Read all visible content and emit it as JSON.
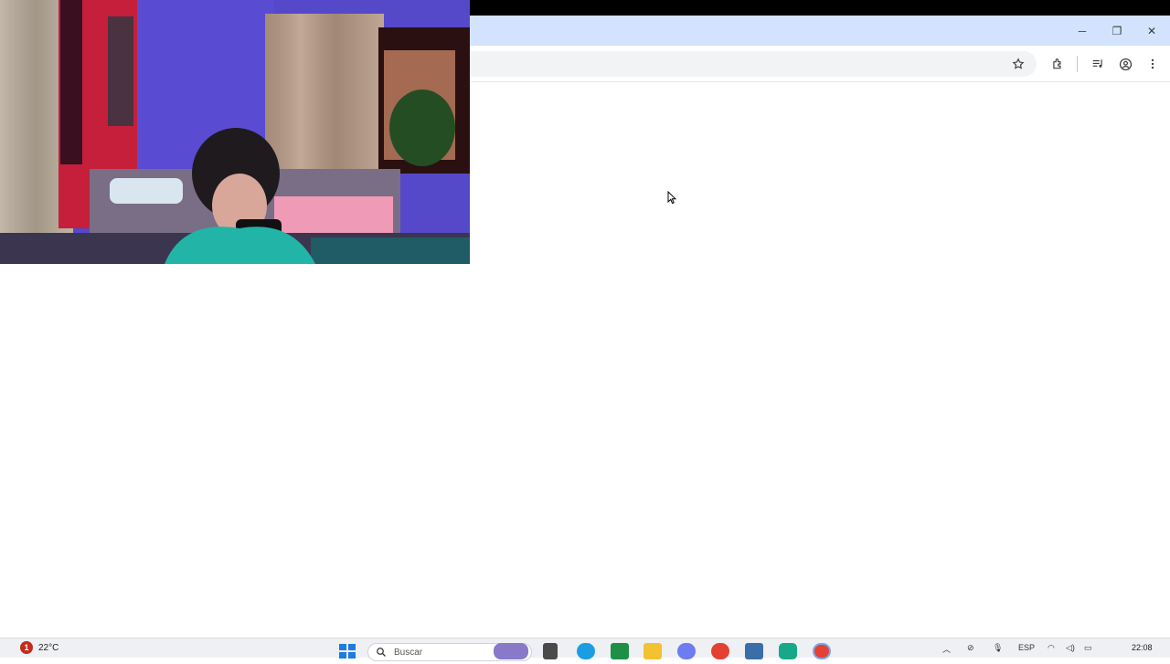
{
  "browser": {
    "window_controls": {
      "minimize": "─",
      "restore": "❐",
      "close": "✕"
    },
    "toolbar_icons": [
      "bookmark-star-icon",
      "extensions-icon",
      "media-controls-icon",
      "profile-icon",
      "menu-icon"
    ]
  },
  "taskbar": {
    "weather": {
      "alert_badge": "1",
      "temperature": "22°C"
    },
    "search_placeholder": "Buscar",
    "apps": [
      "start-icon",
      "search-icon",
      "widgets-icon",
      "task-view-icon",
      "edge-icon",
      "excel-icon",
      "file-explorer-icon",
      "copilot-icon",
      "chrome-icon",
      "calculator-icon",
      "teams-icon",
      "chrome-alt-icon"
    ],
    "tray": {
      "language": "ESP",
      "time": "22:08"
    }
  }
}
